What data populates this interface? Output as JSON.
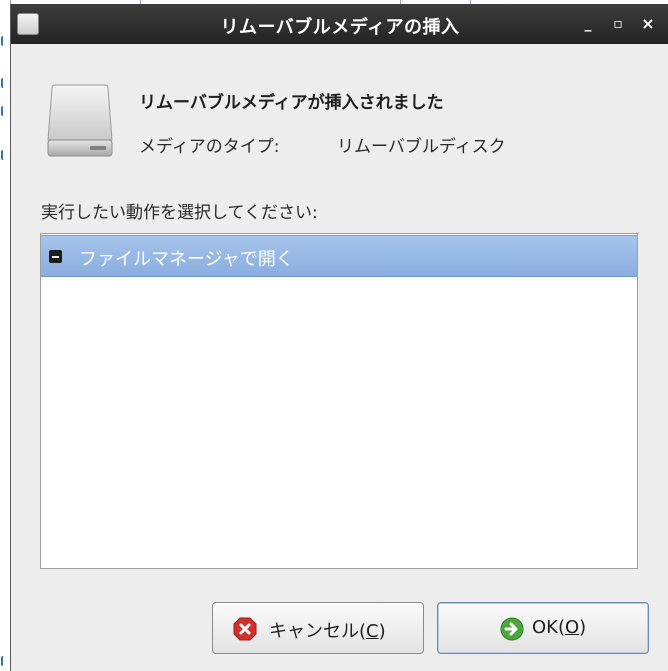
{
  "window": {
    "title": "リムーバブルメディアの挿入",
    "minimize": "_",
    "maximize": "▫",
    "close": "×"
  },
  "header": {
    "heading": "リムーバブルメディアが挿入されました",
    "media_type_label": "メディアのタイプ:",
    "media_type_value": "リムーバブルディスク"
  },
  "prompt": "実行したい動作を選択してください:",
  "actions": [
    {
      "label": "ファイルマネージャで開く",
      "icon": "file-manager-icon",
      "selected": true
    }
  ],
  "buttons": {
    "cancel": {
      "text": "キャンセル(",
      "mnemonic": "C",
      "suffix": ")",
      "icon": "cancel-icon"
    },
    "ok": {
      "text": "OK(",
      "mnemonic": "O",
      "suffix": ")",
      "icon": "ok-arrow-icon"
    }
  },
  "colors": {
    "titlebar": "#2f2f2f",
    "selection": "#94b6e4",
    "cancel_icon": "#d0312d",
    "ok_icon": "#4ca63a"
  }
}
